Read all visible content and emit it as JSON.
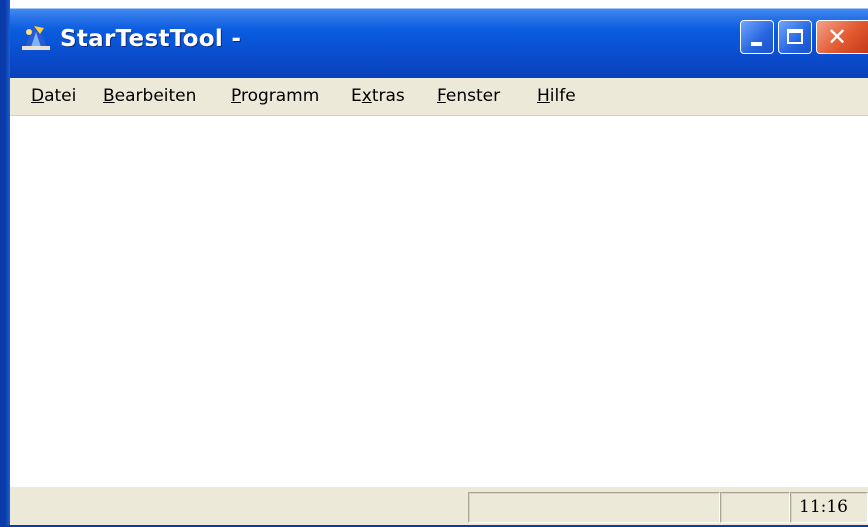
{
  "window": {
    "title": "StarTestTool -",
    "app_icon": "startesttool-app-icon",
    "controls": {
      "minimize": "minimize-icon",
      "maximize": "maximize-icon",
      "close": "close-icon",
      "close_glyph": "✕"
    }
  },
  "menubar": {
    "items": [
      {
        "label": "Datei",
        "mnemonic": "D"
      },
      {
        "label": "Bearbeiten",
        "mnemonic": "B"
      },
      {
        "label": "Programm",
        "mnemonic": "P"
      },
      {
        "label": "Extras",
        "mnemonic": "x"
      },
      {
        "label": "Fenster",
        "mnemonic": "F"
      },
      {
        "label": "Hilfe",
        "mnemonic": "H"
      }
    ]
  },
  "statusbar": {
    "pane_main": "",
    "pane_small": "",
    "clock": "11:16"
  },
  "colors": {
    "titlebar_accent": "#0a5ce0",
    "close_button": "#e25a30",
    "chrome_background": "#ece9d8"
  }
}
